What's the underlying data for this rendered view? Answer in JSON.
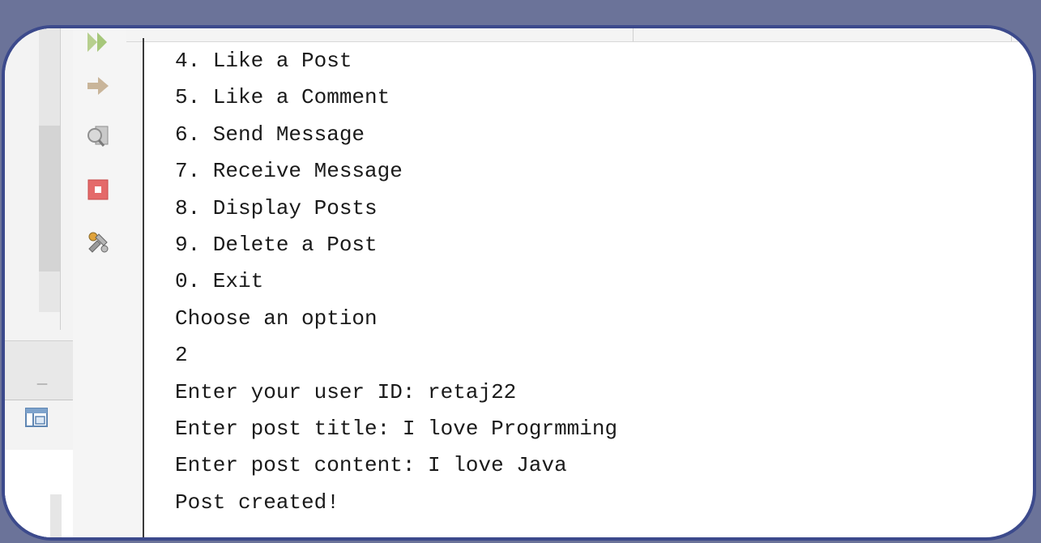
{
  "left_pane": {
    "minimize_label": "—"
  },
  "toolbar": {
    "tools": [
      {
        "name": "rerun-icon",
        "color": "#b7cf8e"
      },
      {
        "name": "step-arrow-icon",
        "color": "#c9b59a"
      },
      {
        "name": "inspect-icon",
        "color": "#a6a6a6"
      },
      {
        "name": "stop-icon",
        "color": "#e05a5a"
      },
      {
        "name": "settings-tools-icon",
        "color": "#8a8a8a"
      }
    ]
  },
  "console": {
    "lines": [
      "4. Like a Post",
      "5. Like a Comment",
      "6. Send Message",
      "7. Receive Message",
      "8. Display Posts",
      "9. Delete a Post",
      "0. Exit",
      "Choose an option",
      "2",
      "Enter your user ID: retaj22",
      "Enter post title: I love Progrmming",
      "Enter post content: I love Java",
      "Post created!",
      "---------------------------------------"
    ]
  }
}
